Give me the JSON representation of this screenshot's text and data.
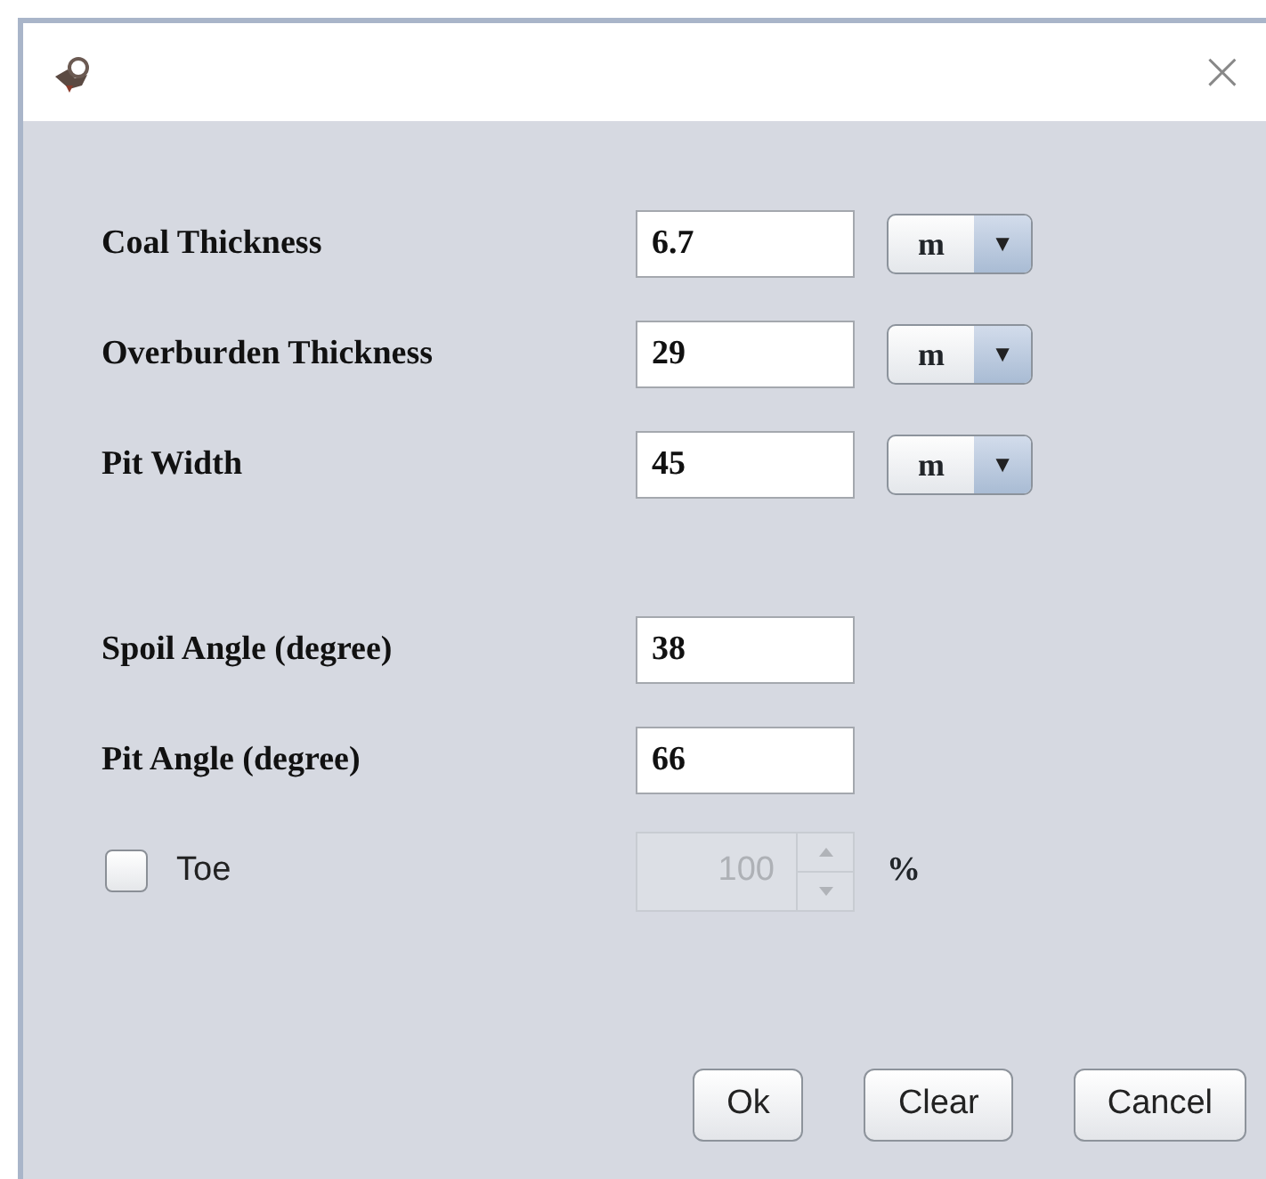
{
  "window": {
    "close_glyph": "×"
  },
  "unit_fields": [
    {
      "label": "Coal Thickness",
      "value": "6.7",
      "unit": "m",
      "arrow": "▼"
    },
    {
      "label": "Overburden Thickness",
      "value": "29",
      "unit": "m",
      "arrow": "▼"
    },
    {
      "label": "Pit Width",
      "value": "45",
      "unit": "m",
      "arrow": "▼"
    }
  ],
  "angle_fields": [
    {
      "label": "Spoil Angle (degree)",
      "value": "38"
    },
    {
      "label": "Pit Angle (degree)",
      "value": "66"
    }
  ],
  "toe": {
    "label": "Toe",
    "checked": false,
    "value": "100",
    "disabled": true,
    "unit": "%"
  },
  "buttons": [
    "Ok",
    "Clear",
    "Cancel"
  ]
}
